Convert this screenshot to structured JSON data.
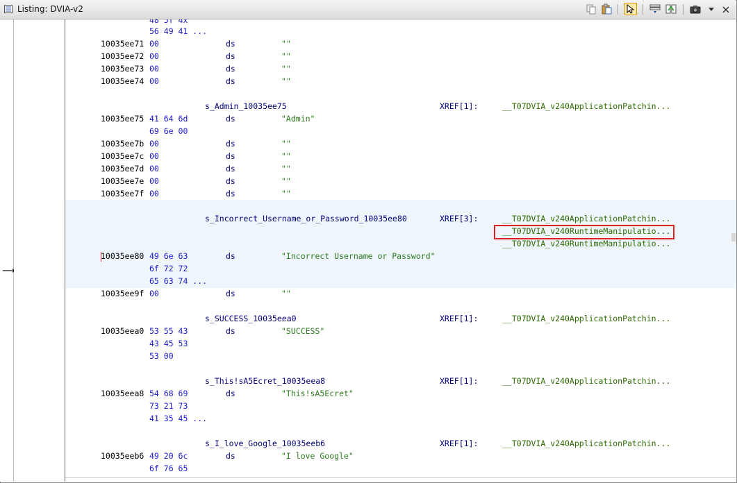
{
  "window": {
    "title": "Listing:  DVIA-v2"
  },
  "toolbar": {
    "icons": [
      "copy-icon",
      "paste-icon",
      "cursor-select-icon",
      "field-options-icon",
      "diff-view-icon",
      "snapshot-icon",
      "dropdown-arrow-icon"
    ]
  },
  "colors": {
    "address": "#000000",
    "bytes": "#1a1ad0",
    "mnemonic": "#00007a",
    "string": "#2d7a1e",
    "xref": "#2d6b00",
    "highlight_band": "#eef5fb",
    "highlight_box": "#e02020"
  },
  "listing": {
    "rows": [
      {
        "bytes": "56 49 41 ..."
      },
      {
        "addr": "10035ee71",
        "bytes": "00",
        "mnem": "ds",
        "operand": "\"\""
      },
      {
        "addr": "10035ee72",
        "bytes": "00",
        "mnem": "ds",
        "operand": "\"\""
      },
      {
        "addr": "10035ee73",
        "bytes": "00",
        "mnem": "ds",
        "operand": "\"\""
      },
      {
        "addr": "10035ee74",
        "bytes": "00",
        "mnem": "ds",
        "operand": "\"\""
      },
      {
        "label": "s_Admin_10035ee75",
        "xref_head": "XREF[1]:",
        "xref": "__T07DVIA_v240ApplicationPatchin..."
      },
      {
        "addr": "10035ee75",
        "bytes": "41 64 6d",
        "mnem": "ds",
        "operand": "\"Admin\""
      },
      {
        "bytes": "69 6e 00"
      },
      {
        "addr": "10035ee7b",
        "bytes": "00",
        "mnem": "ds",
        "operand": "\"\""
      },
      {
        "addr": "10035ee7c",
        "bytes": "00",
        "mnem": "ds",
        "operand": "\"\""
      },
      {
        "addr": "10035ee7d",
        "bytes": "00",
        "mnem": "ds",
        "operand": "\"\""
      },
      {
        "addr": "10035ee7e",
        "bytes": "00",
        "mnem": "ds",
        "operand": "\"\""
      },
      {
        "addr": "10035ee7f",
        "bytes": "00",
        "mnem": "ds",
        "operand": "\"\""
      },
      {
        "label": "s_Incorrect_Username_or_Password_10035ee80",
        "xref_head": "XREF[3]:",
        "xref": "__T07DVIA_v240ApplicationPatchin..."
      },
      {
        "xref": "__T07DVIA_v240RuntimeManipulatio..."
      },
      {
        "xref": "__T07DVIA_v240RuntimeManipulatio..."
      },
      {
        "addr": "10035ee80",
        "bytes": "49 6e 63",
        "mnem": "ds",
        "operand": "\"Incorrect Username or Password\""
      },
      {
        "bytes": "6f 72 72"
      },
      {
        "bytes": "65 63 74 ..."
      },
      {
        "addr": "10035ee9f",
        "bytes": "00",
        "mnem": "ds",
        "operand": "\"\""
      },
      {
        "label": "s_SUCCESS_10035eea0",
        "xref_head": "XREF[1]:",
        "xref": "__T07DVIA_v240ApplicationPatchin..."
      },
      {
        "addr": "10035eea0",
        "bytes": "53 55 43",
        "mnem": "ds",
        "operand": "\"SUCCESS\""
      },
      {
        "bytes": "43 45 53"
      },
      {
        "bytes": "53 00"
      },
      {
        "label": "s_This!sA5Ecret_10035eea8",
        "xref_head": "XREF[1]:",
        "xref": "__T07DVIA_v240ApplicationPatchin..."
      },
      {
        "addr": "10035eea8",
        "bytes": "54 68 69",
        "mnem": "ds",
        "operand": "\"This!sA5Ecret\""
      },
      {
        "bytes": "73 21 73"
      },
      {
        "bytes": "41 35 45 ..."
      },
      {
        "label": "s_I_love_Google_10035eeb6",
        "xref_head": "XREF[1]:",
        "xref": "__T07DVIA_v240ApplicationPatchin..."
      },
      {
        "addr": "10035eeb6",
        "bytes": "49 20 6c",
        "mnem": "ds",
        "operand": "\"I love Google\""
      },
      {
        "bytes": "6f 76 65"
      }
    ]
  }
}
